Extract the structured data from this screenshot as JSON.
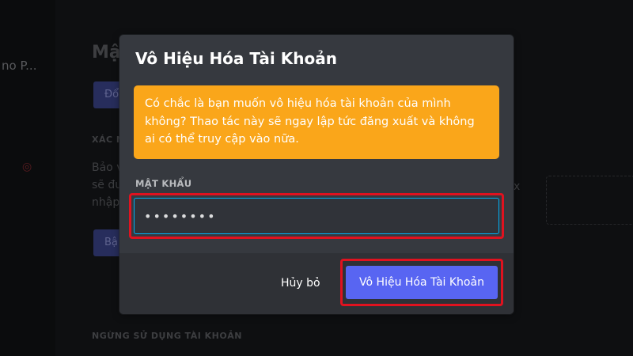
{
  "background": {
    "sidebar_label": "no P...",
    "title": "Mậ",
    "button1_label": "Đổ",
    "section_label": "XÁC N",
    "text_line1": "Bảo v",
    "text_line2": "sẽ đư",
    "text_line3": "nhập",
    "button2_label": "Bậ",
    "section2_label": "NGỪNG SỬ DỤNG TÀI KHOẢN",
    "stray_letter": "x"
  },
  "modal": {
    "title": "Vô Hiệu Hóa Tài Khoản",
    "warning": "Có chắc là bạn muốn vô hiệu hóa tài khoản của mình không? Thao tác này sẽ ngay lập tức đăng xuất và không ai có thể truy cập vào nữa.",
    "password_label": "MẬT KHẨU",
    "password_value": "••••••••",
    "cancel_label": "Hủy bỏ",
    "confirm_label": "Vô Hiệu Hóa Tài Khoản"
  },
  "colors": {
    "modal_bg": "#36393f",
    "footer_bg": "#2f3136",
    "warning_bg": "#faa61a",
    "confirm_bg": "#5865f2",
    "input_focus": "#00b0f4",
    "highlight": "#e0121f"
  }
}
